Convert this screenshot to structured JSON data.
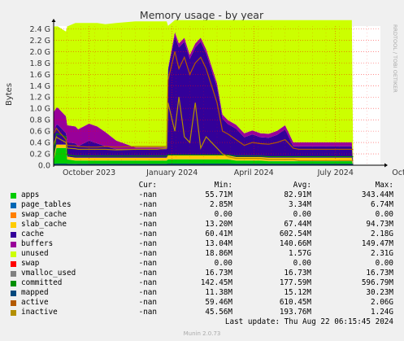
{
  "colors": {
    "background": "#f0f0f0",
    "plot_background": "#ffffff",
    "grid": "#ff0000",
    "axis": "#000000",
    "watermark": "#aaaaaa"
  },
  "watermark": "RRDTOOL / TOBI OETIKER",
  "footer": {
    "last_update": "Last update: Thu Aug 22 06:15:45 2024",
    "version": "Munin 2.0.73"
  },
  "legend": {
    "headers": {
      "cur": "Cur:",
      "min": "Min:",
      "avg": "Avg:",
      "max": "Max:"
    },
    "rows": [
      {
        "name": "apps",
        "color": "#00cc00",
        "cur": "-nan",
        "min": "55.71M",
        "avg": "82.91M",
        "max": "343.44M"
      },
      {
        "name": "page_tables",
        "color": "#0066b3",
        "cur": "-nan",
        "min": "2.85M",
        "avg": "3.34M",
        "max": "6.74M"
      },
      {
        "name": "swap_cache",
        "color": "#ff8000",
        "cur": "-nan",
        "min": "0.00",
        "avg": "0.00",
        "max": "0.00"
      },
      {
        "name": "slab_cache",
        "color": "#ffcc00",
        "cur": "-nan",
        "min": "13.20M",
        "avg": "67.44M",
        "max": "94.73M"
      },
      {
        "name": "cache",
        "color": "#330099",
        "cur": "-nan",
        "min": "60.41M",
        "avg": "602.54M",
        "max": "2.18G"
      },
      {
        "name": "buffers",
        "color": "#990099",
        "cur": "-nan",
        "min": "13.04M",
        "avg": "140.66M",
        "max": "149.47M"
      },
      {
        "name": "unused",
        "color": "#ccff00",
        "cur": "-nan",
        "min": "18.86M",
        "avg": "1.57G",
        "max": "2.31G"
      },
      {
        "name": "swap",
        "color": "#ff0000",
        "cur": "-nan",
        "min": "0.00",
        "avg": "0.00",
        "max": "0.00"
      },
      {
        "name": "vmalloc_used",
        "color": "#808080",
        "cur": "-nan",
        "min": "16.73M",
        "avg": "16.73M",
        "max": "16.73M"
      },
      {
        "name": "committed",
        "color": "#008f00",
        "cur": "-nan",
        "min": "142.45M",
        "avg": "177.59M",
        "max": "596.79M"
      },
      {
        "name": "mapped",
        "color": "#00487d",
        "cur": "-nan",
        "min": "11.38M",
        "avg": "15.12M",
        "max": "30.23M"
      },
      {
        "name": "active",
        "color": "#b35a00",
        "cur": "-nan",
        "min": "59.46M",
        "avg": "610.45M",
        "max": "2.06G"
      },
      {
        "name": "inactive",
        "color": "#b38f00",
        "cur": "-nan",
        "min": "45.56M",
        "avg": "193.76M",
        "max": "1.24G"
      }
    ]
  },
  "chart_data": {
    "type": "area",
    "title": "Memory usage - by year",
    "ylabel": "Bytes",
    "xlabel": "",
    "x_unit": "months since 2023-08-22",
    "xlim": [
      0,
      12
    ],
    "ylim": [
      0,
      2.45
    ],
    "y_unit": "G",
    "y_ticks": [
      {
        "value": 0.0,
        "label": "0.0"
      },
      {
        "value": 0.2,
        "label": "0.2 G"
      },
      {
        "value": 0.4,
        "label": "0.4 G"
      },
      {
        "value": 0.6,
        "label": "0.6 G"
      },
      {
        "value": 0.8,
        "label": "0.8 G"
      },
      {
        "value": 1.0,
        "label": "1.0 G"
      },
      {
        "value": 1.2,
        "label": "1.2 G"
      },
      {
        "value": 1.4,
        "label": "1.4 G"
      },
      {
        "value": 1.6,
        "label": "1.6 G"
      },
      {
        "value": 1.8,
        "label": "1.8 G"
      },
      {
        "value": 2.0,
        "label": "2.0 G"
      },
      {
        "value": 2.2,
        "label": "2.2 G"
      },
      {
        "value": 2.4,
        "label": "2.4 G"
      }
    ],
    "x_ticks": [
      {
        "value": 1.3,
        "label": "October 2023"
      },
      {
        "value": 4.35,
        "label": "January 2024"
      },
      {
        "value": 7.35,
        "label": "April 2024"
      },
      {
        "value": 10.35,
        "label": "July 2024"
      },
      {
        "value": 13.4,
        "label": "October 2024"
      }
    ],
    "data_end": 11.0,
    "grid": true,
    "stack_order": [
      "apps",
      "page_tables",
      "swap_cache",
      "slab_cache",
      "cache",
      "buffers",
      "unused",
      "swap"
    ],
    "x": [
      0.0,
      0.1,
      0.15,
      0.45,
      0.5,
      0.8,
      0.9,
      1.3,
      1.6,
      1.9,
      2.3,
      3.0,
      3.8,
      4.15,
      4.2,
      4.45,
      4.6,
      4.8,
      5.0,
      5.2,
      5.4,
      5.6,
      5.8,
      6.0,
      6.2,
      6.4,
      6.7,
      7.0,
      7.3,
      7.6,
      7.9,
      8.2,
      8.5,
      8.8,
      9.0,
      9.1,
      9.5,
      10.0,
      10.5,
      10.95,
      11.0
    ],
    "series": [
      {
        "name": "apps",
        "values": [
          0.08,
          0.3,
          0.3,
          0.3,
          0.1,
          0.08,
          0.08,
          0.08,
          0.08,
          0.08,
          0.08,
          0.08,
          0.08,
          0.08,
          0.1,
          0.1,
          0.1,
          0.1,
          0.1,
          0.1,
          0.1,
          0.1,
          0.1,
          0.1,
          0.1,
          0.1,
          0.08,
          0.08,
          0.08,
          0.08,
          0.07,
          0.07,
          0.07,
          0.07,
          0.07,
          0.07,
          0.07,
          0.07,
          0.07,
          0.07,
          0.0
        ]
      },
      {
        "name": "page_tables",
        "values": [
          0.003,
          0.004,
          0.004,
          0.004,
          0.003,
          0.003,
          0.003,
          0.003,
          0.003,
          0.003,
          0.003,
          0.003,
          0.003,
          0.003,
          0.004,
          0.004,
          0.004,
          0.004,
          0.004,
          0.004,
          0.004,
          0.004,
          0.004,
          0.004,
          0.004,
          0.004,
          0.003,
          0.003,
          0.003,
          0.003,
          0.003,
          0.003,
          0.003,
          0.003,
          0.003,
          0.003,
          0.003,
          0.003,
          0.003,
          0.003,
          0.0
        ]
      },
      {
        "name": "swap_cache",
        "values": [
          0,
          0,
          0,
          0,
          0,
          0,
          0,
          0,
          0,
          0,
          0,
          0,
          0,
          0,
          0,
          0,
          0,
          0,
          0,
          0,
          0,
          0,
          0,
          0,
          0,
          0,
          0,
          0,
          0,
          0,
          0,
          0,
          0,
          0,
          0,
          0,
          0,
          0,
          0,
          0,
          0
        ]
      },
      {
        "name": "slab_cache",
        "values": [
          0.05,
          0.06,
          0.06,
          0.06,
          0.05,
          0.05,
          0.05,
          0.05,
          0.05,
          0.05,
          0.05,
          0.05,
          0.05,
          0.05,
          0.07,
          0.07,
          0.07,
          0.07,
          0.07,
          0.07,
          0.07,
          0.07,
          0.07,
          0.07,
          0.07,
          0.07,
          0.06,
          0.06,
          0.06,
          0.06,
          0.06,
          0.06,
          0.06,
          0.06,
          0.06,
          0.06,
          0.06,
          0.06,
          0.06,
          0.06,
          0.0
        ]
      },
      {
        "name": "cache",
        "values": [
          0.45,
          0.35,
          0.35,
          0.2,
          0.25,
          0.25,
          0.2,
          0.3,
          0.25,
          0.2,
          0.15,
          0.15,
          0.15,
          0.15,
          1.5,
          2.1,
          1.9,
          2.0,
          1.7,
          1.9,
          2.0,
          1.8,
          1.5,
          1.2,
          0.65,
          0.55,
          0.5,
          0.35,
          0.4,
          0.35,
          0.35,
          0.4,
          0.5,
          0.2,
          0.2,
          0.2,
          0.2,
          0.2,
          0.2,
          0.2,
          0.0
        ]
      },
      {
        "name": "buffers",
        "values": [
          0.35,
          0.3,
          0.3,
          0.3,
          0.3,
          0.3,
          0.3,
          0.3,
          0.3,
          0.25,
          0.15,
          0.03,
          0.03,
          0.03,
          0.03,
          0.07,
          0.07,
          0.07,
          0.07,
          0.07,
          0.07,
          0.07,
          0.07,
          0.07,
          0.07,
          0.07,
          0.07,
          0.07,
          0.07,
          0.07,
          0.07,
          0.07,
          0.07,
          0.07,
          0.07,
          0.07,
          0.07,
          0.07,
          0.07,
          0.07,
          0.0
        ]
      },
      {
        "name": "unused",
        "values": [
          1.51,
          1.43,
          1.43,
          1.49,
          1.74,
          1.82,
          1.87,
          1.77,
          1.82,
          1.9,
          2.07,
          2.22,
          2.22,
          2.22,
          0.75,
          0.21,
          0.41,
          0.31,
          0.61,
          0.41,
          0.31,
          0.51,
          0.81,
          1.11,
          1.66,
          1.76,
          1.84,
          1.99,
          1.94,
          1.99,
          2.0,
          1.95,
          1.85,
          2.15,
          2.15,
          2.15,
          2.15,
          2.15,
          2.15,
          2.15,
          0.0
        ]
      },
      {
        "name": "swap",
        "values": [
          0,
          0,
          0,
          0,
          0,
          0,
          0,
          0,
          0,
          0,
          0,
          0,
          0,
          0,
          0,
          0,
          0,
          0,
          0,
          0,
          0,
          0,
          0,
          0,
          0,
          0,
          0,
          0,
          0,
          0,
          0,
          0,
          0,
          0,
          0,
          0,
          0,
          0,
          0,
          0,
          0
        ]
      },
      {
        "name": "vmalloc_used",
        "values": [
          0.017,
          0.017,
          0.017,
          0.017,
          0.017,
          0.017,
          0.017,
          0.017,
          0.017,
          0.017,
          0.017,
          0.017,
          0.017,
          0.017,
          0.017,
          0.017,
          0.017,
          0.017,
          0.017,
          0.017,
          0.017,
          0.017,
          0.017,
          0.017,
          0.017,
          0.017,
          0.017,
          0.017,
          0.017,
          0.017,
          0.017,
          0.017,
          0.017,
          0.017,
          0.017,
          0.017,
          0.017,
          0.017,
          0.017,
          0.017,
          0.017
        ]
      },
      {
        "name": "committed",
        "values": [
          0.15,
          0.55,
          0.55,
          0.5,
          0.18,
          0.16,
          0.16,
          0.16,
          0.16,
          0.16,
          0.16,
          0.16,
          0.16,
          0.16,
          0.18,
          0.18,
          0.18,
          0.18,
          0.18,
          0.18,
          0.18,
          0.18,
          0.18,
          0.18,
          0.18,
          0.18,
          0.16,
          0.16,
          0.16,
          0.16,
          0.15,
          0.15,
          0.15,
          0.15,
          0.15,
          0.15,
          0.15,
          0.15,
          0.15,
          0.15,
          0.15
        ]
      },
      {
        "name": "mapped",
        "values": [
          0.012,
          0.02,
          0.02,
          0.02,
          0.015,
          0.012,
          0.012,
          0.012,
          0.012,
          0.012,
          0.012,
          0.012,
          0.012,
          0.012,
          0.02,
          0.02,
          0.02,
          0.02,
          0.02,
          0.02,
          0.02,
          0.02,
          0.02,
          0.02,
          0.02,
          0.02,
          0.015,
          0.015,
          0.015,
          0.015,
          0.015,
          0.015,
          0.015,
          0.015,
          0.015,
          0.015,
          0.015,
          0.015,
          0.015,
          0.015,
          0.015
        ]
      },
      {
        "name": "active",
        "values": [
          0.55,
          0.65,
          0.62,
          0.45,
          0.35,
          0.34,
          0.33,
          0.32,
          0.32,
          0.33,
          0.32,
          0.33,
          0.33,
          0.33,
          1.5,
          2.0,
          1.7,
          1.9,
          1.6,
          1.8,
          1.9,
          1.7,
          1.4,
          1.1,
          0.6,
          0.55,
          0.45,
          0.35,
          0.4,
          0.38,
          0.37,
          0.4,
          0.45,
          0.3,
          0.28,
          0.28,
          0.28,
          0.28,
          0.28,
          0.28,
          0.28
        ]
      },
      {
        "name": "inactive",
        "values": [
          0.35,
          0.5,
          0.48,
          0.4,
          0.3,
          0.29,
          0.28,
          0.28,
          0.28,
          0.28,
          0.27,
          0.28,
          0.28,
          0.3,
          1.1,
          0.6,
          1.2,
          0.5,
          0.4,
          1.1,
          0.3,
          0.5,
          0.4,
          0.3,
          0.2,
          0.15,
          0.12,
          0.12,
          0.12,
          0.12,
          0.1,
          0.1,
          0.1,
          0.1,
          0.08,
          0.08,
          0.08,
          0.08,
          0.08,
          0.08,
          0.08
        ]
      }
    ]
  }
}
